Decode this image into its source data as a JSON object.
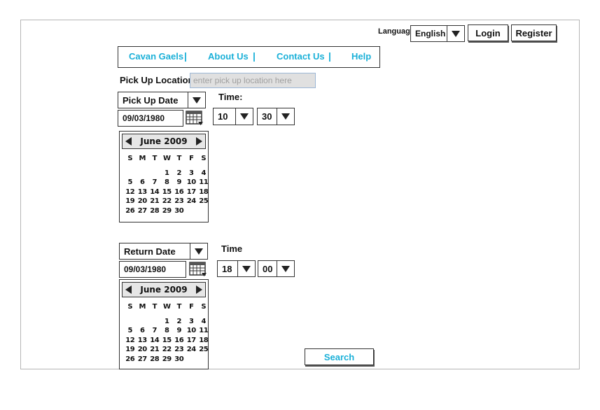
{
  "header": {
    "language_label": "Language",
    "language_value": "English",
    "login_label": "Login",
    "register_label": "Register"
  },
  "nav": {
    "items": [
      "Cavan Gaels",
      "About Us",
      "Contact Us",
      "Help"
    ],
    "separator": "|"
  },
  "pickup": {
    "location_label": "Pick Up Location",
    "location_placeholder": "enter pick up location here",
    "date_type": "Pick Up Date",
    "date_value": "09/03/1980",
    "time_label": "Time:",
    "hour": "10",
    "minute": "30",
    "calendar": {
      "title": "June 2009",
      "weekdays": [
        "S",
        "M",
        "T",
        "W",
        "T",
        "F",
        "S"
      ],
      "weeks": [
        [
          "",
          "",
          "",
          "1",
          "2",
          "3",
          "4"
        ],
        [
          "5",
          "6",
          "7",
          "8",
          "9",
          "10",
          "11"
        ],
        [
          "12",
          "13",
          "14",
          "15",
          "16",
          "17",
          "18"
        ],
        [
          "19",
          "20",
          "21",
          "22",
          "23",
          "24",
          "25"
        ],
        [
          "26",
          "27",
          "28",
          "29",
          "30",
          "",
          ""
        ]
      ]
    }
  },
  "return": {
    "date_type": "Return Date",
    "date_value": "09/03/1980",
    "time_label": "Time",
    "hour": "18",
    "minute": "00",
    "calendar": {
      "title": "June 2009",
      "weekdays": [
        "S",
        "M",
        "T",
        "W",
        "T",
        "F",
        "S"
      ],
      "weeks": [
        [
          "",
          "",
          "",
          "1",
          "2",
          "3",
          "4"
        ],
        [
          "5",
          "6",
          "7",
          "8",
          "9",
          "10",
          "11"
        ],
        [
          "12",
          "13",
          "14",
          "15",
          "16",
          "17",
          "18"
        ],
        [
          "19",
          "20",
          "21",
          "22",
          "23",
          "24",
          "25"
        ],
        [
          "26",
          "27",
          "28",
          "29",
          "30",
          "",
          ""
        ]
      ]
    }
  },
  "search_label": "Search",
  "colors": {
    "link": "#1ab0d8",
    "input_bg": "#e0e0e0"
  }
}
